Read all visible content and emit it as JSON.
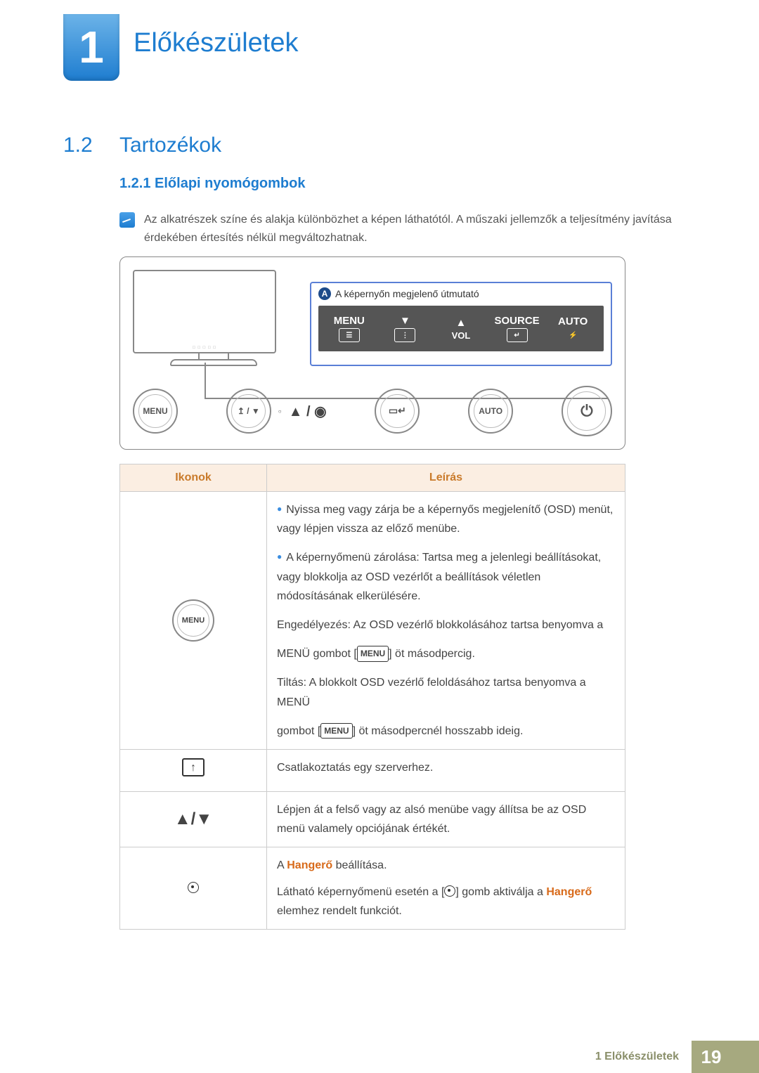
{
  "chapter": {
    "number": "1",
    "title": "Előkészületek"
  },
  "section": {
    "number": "1.2",
    "title": "Tartozékok"
  },
  "subsection": {
    "number_title": "1.2.1 Előlapi nyomógombok"
  },
  "note": "Az alkatrészek színe és alakja különbözhet a képen láthatótól. A műszaki jellemzők a teljesítmény javítása érdekében értesítés nélkül megváltozhatnak.",
  "diagram": {
    "legend_marker": "A",
    "legend_text": "A képernyőn megjelenő útmutató",
    "strip": {
      "items": [
        {
          "top": "MENU",
          "icon": "menu"
        },
        {
          "top": "▼",
          "icon": "vol-down"
        },
        {
          "top": "▲",
          "mid": "VOL",
          "icon": "vol-up"
        },
        {
          "top": "SOURCE",
          "icon": "enter"
        },
        {
          "top": "AUTO",
          "icon": "auto"
        }
      ]
    },
    "buttons": {
      "menu": "MENU",
      "auto": "AUTO"
    }
  },
  "table": {
    "headers": {
      "icons": "Ikonok",
      "desc": "Leírás"
    },
    "rows": [
      {
        "icon_label": "MENU",
        "lines": {
          "l1": "Nyissa meg vagy zárja be a képernyős megjelenítő (OSD) menüt, vagy lépjen vissza az előző menübe.",
          "l2a": "A képernyőmenü zárolása: Tartsa meg a jelenlegi beállításokat, vagy blokkolja az OSD vezérlőt a beállítások véletlen módosításának elkerülésére.",
          "l2b": "Engedélyezés: Az OSD vezérlő blokkolásához tartsa benyomva a",
          "l2c_pre": "MENÜ gombot [",
          "chip": "MENU",
          "l2c_post": "] öt másodpercig.",
          "l2d": "Tiltás: A blokkolt OSD vezérlő feloldásához tartsa benyomva a MENÜ",
          "l2e_pre": "gombot [",
          "l2e_post": "] öt másodpercnél hosszabb ideig."
        }
      },
      {
        "icon_type": "upload",
        "text": "Csatlakoztatás egy szerverhez."
      },
      {
        "icon_type": "arrows",
        "icon_text": "▲/▼",
        "text": "Lépjen át a felső vagy az alsó menübe vagy állítsa be az OSD menü valamely opciójának értékét."
      },
      {
        "icon_type": "target",
        "line1_pre": "A ",
        "line1_strong": "Hangerő",
        "line1_post": " beállítása.",
        "line2_pre": "Látható képernyőmenü esetén a [",
        "line2_mid": "] gomb aktiválja a ",
        "line2_strong": "Hangerő",
        "line2_post": " elemhez rendelt funkciót."
      }
    ]
  },
  "footer": {
    "label": "1 Előkészületek",
    "page": "19"
  }
}
